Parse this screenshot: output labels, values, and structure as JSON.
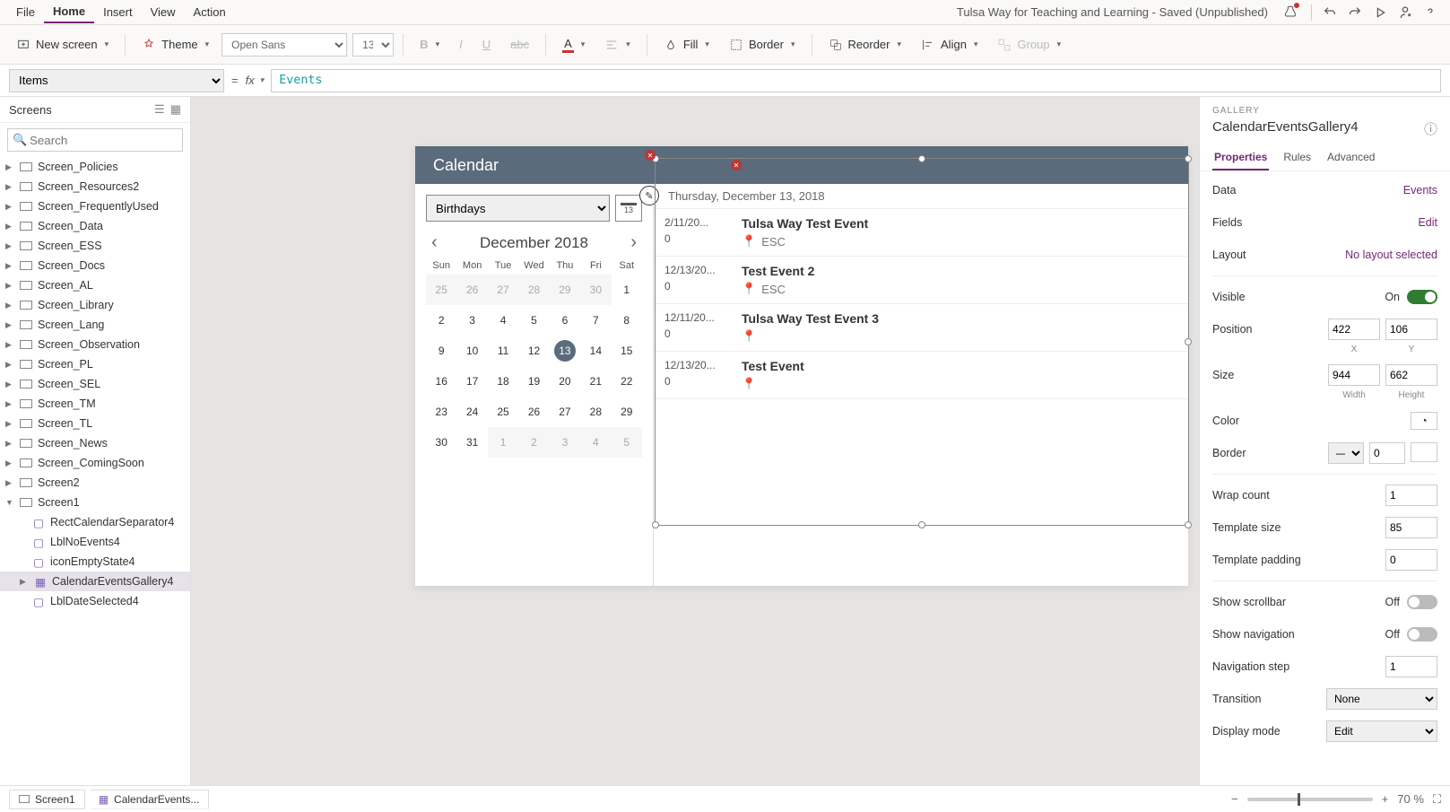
{
  "menubar": {
    "items": [
      "File",
      "Home",
      "Insert",
      "View",
      "Action"
    ],
    "active": "Home",
    "title": "Tulsa Way for Teaching and Learning - Saved (Unpublished)"
  },
  "ribbon": {
    "new_screen": "New screen",
    "theme": "Theme",
    "font_name": "Open Sans",
    "font_size": "13",
    "fill": "Fill",
    "border": "Border",
    "reorder": "Reorder",
    "align": "Align",
    "group": "Group"
  },
  "formula": {
    "property": "Items",
    "value": "Events"
  },
  "left_panel": {
    "title": "Screens",
    "search_placeholder": "Search",
    "screens": [
      "Screen_Policies",
      "Screen_Resources2",
      "Screen_FrequentlyUsed",
      "Screen_Data",
      "Screen_ESS",
      "Screen_Docs",
      "Screen_AL",
      "Screen_Library",
      "Screen_Lang",
      "Screen_Observation",
      "Screen_PL",
      "Screen_SEL",
      "Screen_TM",
      "Screen_TL",
      "Screen_News",
      "Screen_ComingSoon",
      "Screen2"
    ],
    "open_screen": "Screen1",
    "children": [
      "RectCalendarSeparator4",
      "LblNoEvents4",
      "iconEmptyState4"
    ],
    "selected_child": "CalendarEventsGallery4",
    "after_selected": "LblDateSelected4"
  },
  "canvas": {
    "title": "Calendar",
    "calendar_select": "Birthdays",
    "date_button": "13",
    "month": "December 2018",
    "dow": [
      "Sun",
      "Mon",
      "Tue",
      "Wed",
      "Thu",
      "Fri",
      "Sat"
    ],
    "weeks": [
      [
        {
          "n": "25",
          "dim": true
        },
        {
          "n": "26",
          "dim": true
        },
        {
          "n": "27",
          "dim": true
        },
        {
          "n": "28",
          "dim": true
        },
        {
          "n": "29",
          "dim": true
        },
        {
          "n": "30",
          "dim": true
        },
        {
          "n": "1"
        }
      ],
      [
        {
          "n": "2"
        },
        {
          "n": "3"
        },
        {
          "n": "4"
        },
        {
          "n": "5"
        },
        {
          "n": "6"
        },
        {
          "n": "7"
        },
        {
          "n": "8"
        }
      ],
      [
        {
          "n": "9"
        },
        {
          "n": "10"
        },
        {
          "n": "11"
        },
        {
          "n": "12"
        },
        {
          "n": "13",
          "sel": true
        },
        {
          "n": "14"
        },
        {
          "n": "15"
        }
      ],
      [
        {
          "n": "16"
        },
        {
          "n": "17"
        },
        {
          "n": "18"
        },
        {
          "n": "19"
        },
        {
          "n": "20"
        },
        {
          "n": "21"
        },
        {
          "n": "22"
        }
      ],
      [
        {
          "n": "23"
        },
        {
          "n": "24"
        },
        {
          "n": "25"
        },
        {
          "n": "26"
        },
        {
          "n": "27"
        },
        {
          "n": "28"
        },
        {
          "n": "29"
        }
      ],
      [
        {
          "n": "30"
        },
        {
          "n": "31"
        },
        {
          "n": "1",
          "dim": true
        },
        {
          "n": "2",
          "dim": true
        },
        {
          "n": "3",
          "dim": true
        },
        {
          "n": "4",
          "dim": true
        },
        {
          "n": "5",
          "dim": true
        }
      ]
    ],
    "selected_date": "Thursday, December 13, 2018",
    "events": [
      {
        "date": "2/11/20...",
        "dur": "0",
        "title": "Tulsa Way Test Event",
        "loc": "ESC"
      },
      {
        "date": "12/13/20...",
        "dur": "0",
        "title": "Test Event 2",
        "loc": "ESC"
      },
      {
        "date": "12/11/20...",
        "dur": "0",
        "title": "Tulsa Way Test Event 3",
        "loc": ""
      },
      {
        "date": "12/13/20...",
        "dur": "0",
        "title": "Test Event",
        "loc": ""
      }
    ]
  },
  "properties": {
    "section": "GALLERY",
    "name": "CalendarEventsGallery4",
    "tabs": [
      "Properties",
      "Rules",
      "Advanced"
    ],
    "data_label": "Data",
    "data_value": "Events",
    "fields_label": "Fields",
    "fields_value": "Edit",
    "layout_label": "Layout",
    "layout_value": "No layout selected",
    "visible_label": "Visible",
    "visible_value": "On",
    "position_label": "Position",
    "x": "422",
    "y": "106",
    "x_lbl": "X",
    "y_lbl": "Y",
    "size_label": "Size",
    "w": "944",
    "h": "662",
    "w_lbl": "Width",
    "h_lbl": "Height",
    "color_label": "Color",
    "border_label": "Border",
    "border_value": "0",
    "wrap_label": "Wrap count",
    "wrap_value": "1",
    "tsize_label": "Template size",
    "tsize_value": "85",
    "tpad_label": "Template padding",
    "tpad_value": "0",
    "scroll_label": "Show scrollbar",
    "scroll_value": "Off",
    "nav_label": "Show navigation",
    "nav_value": "Off",
    "navstep_label": "Navigation step",
    "navstep_value": "1",
    "trans_label": "Transition",
    "trans_value": "None",
    "mode_label": "Display mode",
    "mode_value": "Edit"
  },
  "statusbar": {
    "crumb1": "Screen1",
    "crumb2": "CalendarEvents...",
    "zoom": "70",
    "zoom_unit": "%"
  }
}
